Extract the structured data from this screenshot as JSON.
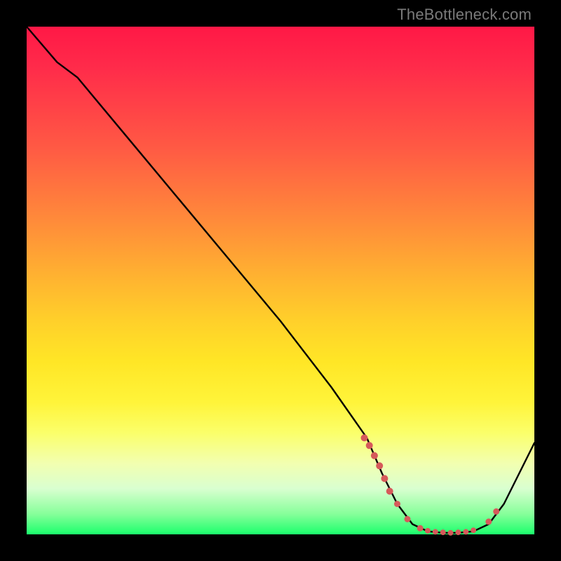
{
  "watermark": "TheBottleneck.com",
  "chart_data": {
    "type": "line",
    "title": "",
    "xlabel": "",
    "ylabel": "",
    "xlim": [
      0,
      100
    ],
    "ylim": [
      0,
      100
    ],
    "grid": false,
    "legend": false,
    "series": [
      {
        "name": "bottleneck-curve",
        "x": [
          0,
          6,
          10,
          20,
          30,
          40,
          50,
          60,
          67,
          70,
          73,
          76,
          79,
          82,
          85,
          88,
          91,
          94,
          100
        ],
        "y": [
          100,
          93,
          90,
          78,
          66,
          54,
          42,
          29,
          19,
          12,
          6,
          2,
          0.6,
          0.3,
          0.3,
          0.6,
          2,
          6,
          18
        ]
      }
    ],
    "markers": {
      "name": "highlight-points",
      "color": "#d65a5a",
      "points": [
        {
          "x": 66.5,
          "y": 19.0,
          "r": 5
        },
        {
          "x": 67.5,
          "y": 17.5,
          "r": 5
        },
        {
          "x": 68.5,
          "y": 15.5,
          "r": 5
        },
        {
          "x": 69.5,
          "y": 13.5,
          "r": 5
        },
        {
          "x": 70.5,
          "y": 11.0,
          "r": 5
        },
        {
          "x": 71.5,
          "y": 8.5,
          "r": 5
        },
        {
          "x": 73.0,
          "y": 6.0,
          "r": 4.5
        },
        {
          "x": 75.0,
          "y": 3.0,
          "r": 4.5
        },
        {
          "x": 77.5,
          "y": 1.2,
          "r": 4.5
        },
        {
          "x": 79.0,
          "y": 0.7,
          "r": 4
        },
        {
          "x": 80.5,
          "y": 0.5,
          "r": 4
        },
        {
          "x": 82.0,
          "y": 0.4,
          "r": 4
        },
        {
          "x": 83.5,
          "y": 0.3,
          "r": 4
        },
        {
          "x": 85.0,
          "y": 0.4,
          "r": 4
        },
        {
          "x": 86.5,
          "y": 0.5,
          "r": 4
        },
        {
          "x": 88.0,
          "y": 0.8,
          "r": 4
        },
        {
          "x": 91.0,
          "y": 2.5,
          "r": 4.5
        },
        {
          "x": 92.5,
          "y": 4.5,
          "r": 4.5
        }
      ]
    }
  }
}
